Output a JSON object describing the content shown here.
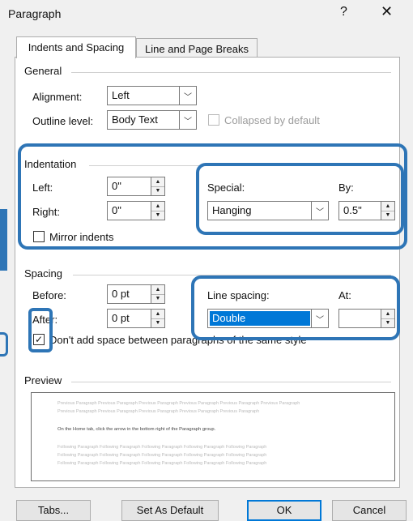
{
  "window": {
    "title": "Paragraph",
    "help_glyph": "?",
    "close_glyph": "✕"
  },
  "tabs": [
    {
      "label": "Indents and Spacing",
      "active": true
    },
    {
      "label": "Line and Page Breaks",
      "active": false
    }
  ],
  "general": {
    "heading": "General",
    "alignment_label": "Alignment:",
    "alignment_value": "Left",
    "outline_label": "Outline level:",
    "outline_value": "Body Text",
    "collapsed_label": "Collapsed by default"
  },
  "indentation": {
    "heading": "Indentation",
    "left_label": "Left:",
    "left_value": "0\"",
    "right_label": "Right:",
    "right_value": "0\"",
    "special_label": "Special:",
    "special_value": "Hanging",
    "by_label": "By:",
    "by_value": "0.5\"",
    "mirror_label": "Mirror indents"
  },
  "spacing": {
    "heading": "Spacing",
    "before_label": "Before:",
    "before_value": "0 pt",
    "after_label": "After:",
    "after_value": "0 pt",
    "line_spacing_label": "Line spacing:",
    "line_spacing_value": "Double",
    "at_label": "At:",
    "at_value": "",
    "dont_add_label": "Don't add space between paragraphs of the same style",
    "dont_add_checked": true
  },
  "preview": {
    "heading": "Preview",
    "previous_line_1": "Previous Paragraph Previous Paragraph Previous Paragraph Previous Paragraph Previous Paragraph Previous Paragraph",
    "previous_line_2": "Previous Paragraph Previous Paragraph Previous Paragraph Previous Paragraph Previous Paragraph",
    "current_line": "On the Home tab, click the arrow in the bottom right of the Paragraph group.",
    "following_line_1": "Following Paragraph Following Paragraph Following Paragraph Following Paragraph Following Paragraph",
    "following_line_2": "Following Paragraph Following Paragraph Following Paragraph Following Paragraph Following Paragraph",
    "following_line_3": "Following Paragraph Following Paragraph Following Paragraph Following Paragraph Following Paragraph"
  },
  "buttons": {
    "tabs": "Tabs...",
    "set_default": "Set As Default",
    "ok": "OK",
    "cancel": "Cancel"
  },
  "colors": {
    "highlight": "#2e75b6",
    "selection": "#0078d7",
    "ok_border": "#0078d7"
  }
}
